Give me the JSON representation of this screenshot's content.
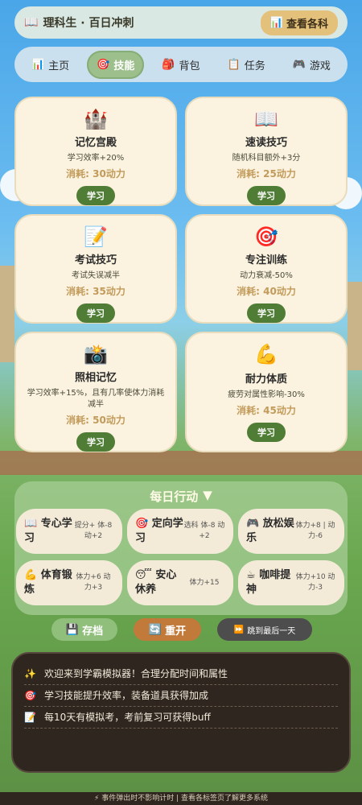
{
  "topbar": {
    "title_icon": "📖",
    "title": "理科生 · 百日冲刺",
    "subjects_icon": "📊",
    "subjects_label": "查看各科"
  },
  "tabs": [
    {
      "icon": "📊",
      "label": "主页",
      "active": false
    },
    {
      "icon": "🎯",
      "label": "技能",
      "active": true
    },
    {
      "icon": "🎒",
      "label": "背包",
      "active": false
    },
    {
      "icon": "📋",
      "label": "任务",
      "active": false
    },
    {
      "icon": "🎮",
      "label": "游戏",
      "active": false
    }
  ],
  "skills": [
    {
      "icon": "🏰",
      "name": "记忆宫殿",
      "desc": "学习效率+20%",
      "cost": "消耗: 30动力",
      "button": "学习"
    },
    {
      "icon": "📖",
      "name": "速读技巧",
      "desc": "随机科目额外+3分",
      "cost": "消耗: 25动力",
      "button": "学习"
    },
    {
      "icon": "📝",
      "name": "考试技巧",
      "desc": "考试失误减半",
      "cost": "消耗: 35动力",
      "button": "学习"
    },
    {
      "icon": "🎯",
      "name": "专注训练",
      "desc": "动力衰减-50%",
      "cost": "消耗: 40动力",
      "button": "学习"
    },
    {
      "icon": "📸",
      "name": "照相记忆",
      "desc": "学习效率+15%，且有几率使体力消耗减半",
      "cost": "消耗: 50动力",
      "button": "学习"
    },
    {
      "icon": "💪",
      "name": "耐力体质",
      "desc": "疲劳对属性影响-30%",
      "cost": "消耗: 45动力",
      "button": "学习"
    }
  ],
  "daily": {
    "title": "每日行动",
    "toggle_icon": "▼",
    "actions": [
      {
        "icon": "📖",
        "name": "专心学习",
        "effect": "提分+ 体-8 动+2"
      },
      {
        "icon": "🎯",
        "name": "定向学习",
        "effect": "选科 体-8 动+2"
      },
      {
        "icon": "🎮",
        "name": "放松娱乐",
        "effect": "体力+8 | 动力-6"
      },
      {
        "icon": "💪",
        "name": "体育锻炼",
        "effect": "体力+6 动力+3"
      },
      {
        "icon": "😴",
        "name": "安心休养",
        "effect": "体力+15"
      },
      {
        "icon": "☕",
        "name": "咖啡提神",
        "effect": "体力+10 动力-3"
      }
    ]
  },
  "buttons": {
    "save_icon": "💾",
    "save": "存档",
    "restart_icon": "🔄",
    "restart": "重开",
    "skip_icon": "⏩",
    "skip": "跳到最后一天"
  },
  "log": [
    {
      "icon": "✨",
      "text": "欢迎来到学霸模拟器！合理分配时间和属性"
    },
    {
      "icon": "🎯",
      "text": "学习技能提升效率，装备道具获得加成"
    },
    {
      "icon": "📝",
      "text": "每10天有模拟考，考前复习可获得buff"
    }
  ],
  "footer": "⚡ 事件弹出时不影响计时 | 查看各标签页了解更多系统"
}
